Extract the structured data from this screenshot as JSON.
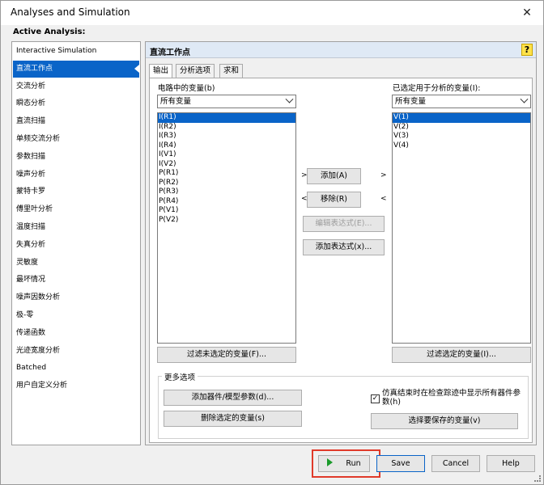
{
  "window": {
    "title": "Analyses and Simulation",
    "close_symbol": "✕"
  },
  "active_analysis_label": "Active Analysis:",
  "sidebar": {
    "selected_index": 1,
    "items": [
      "Interactive Simulation",
      "直流工作点",
      "交流分析",
      "瞬态分析",
      "直流扫描",
      "单频交流分析",
      "参数扫描",
      "噪声分析",
      "蒙特卡罗",
      "傅里叶分析",
      "温度扫描",
      "失真分析",
      "灵敏度",
      "最坏情况",
      "噪声因数分析",
      "极-零",
      "传递函数",
      "光迹宽度分析",
      "Batched",
      "用户自定义分析"
    ]
  },
  "panel": {
    "title": "直流工作点",
    "help_symbol": "?",
    "tabs": [
      "输出",
      "分析选项",
      "求和"
    ],
    "active_tab": 0
  },
  "output": {
    "circuit_vars_label": "电路中的变量(b)",
    "circuit_filter_value": "所有变量",
    "circuit_variables": [
      "I(R1)",
      "I(R2)",
      "I(R3)",
      "I(R4)",
      "I(V1)",
      "I(V2)",
      "P(R1)",
      "P(R2)",
      "P(R3)",
      "P(R4)",
      "P(V1)",
      "P(V2)"
    ],
    "circuit_selected_index": 0,
    "selected_vars_label": "已选定用于分析的变量(I):",
    "selected_filter_value": "所有变量",
    "selected_variables": [
      "V(1)",
      "V(2)",
      "V(3)",
      "V(4)"
    ],
    "selected_selected_index": 0,
    "add_button": "添加(A)",
    "remove_button": "移除(R)",
    "edit_expression_button": "编辑表达式(E)...",
    "add_expression_button": "添加表达式(x)...",
    "filter_unselected_button": "过滤未选定的变量(F)...",
    "filter_selected_button": "过滤选定的变量(I)...",
    "arrow_right": ">",
    "arrow_left": "<"
  },
  "more_options": {
    "title": "更多选项",
    "add_device_params_button": "添加器件/模型参数(d)...",
    "delete_selected_button": "删除选定的变量(s)",
    "show_params_checkbox_label": "仿真结束时在检查踪迹中显示所有器件参数(h)",
    "show_params_checked": true,
    "check_mark": "✓",
    "select_saved_vars_button": "选择要保存的变量(v)"
  },
  "footer": {
    "run_button": "Run",
    "save_button": "Save",
    "cancel_button": "Cancel",
    "help_button": "Help"
  },
  "colors": {
    "selection": "#0a64c8",
    "run_highlight": "#e03a2a",
    "play_icon": "#1a9a2a"
  }
}
